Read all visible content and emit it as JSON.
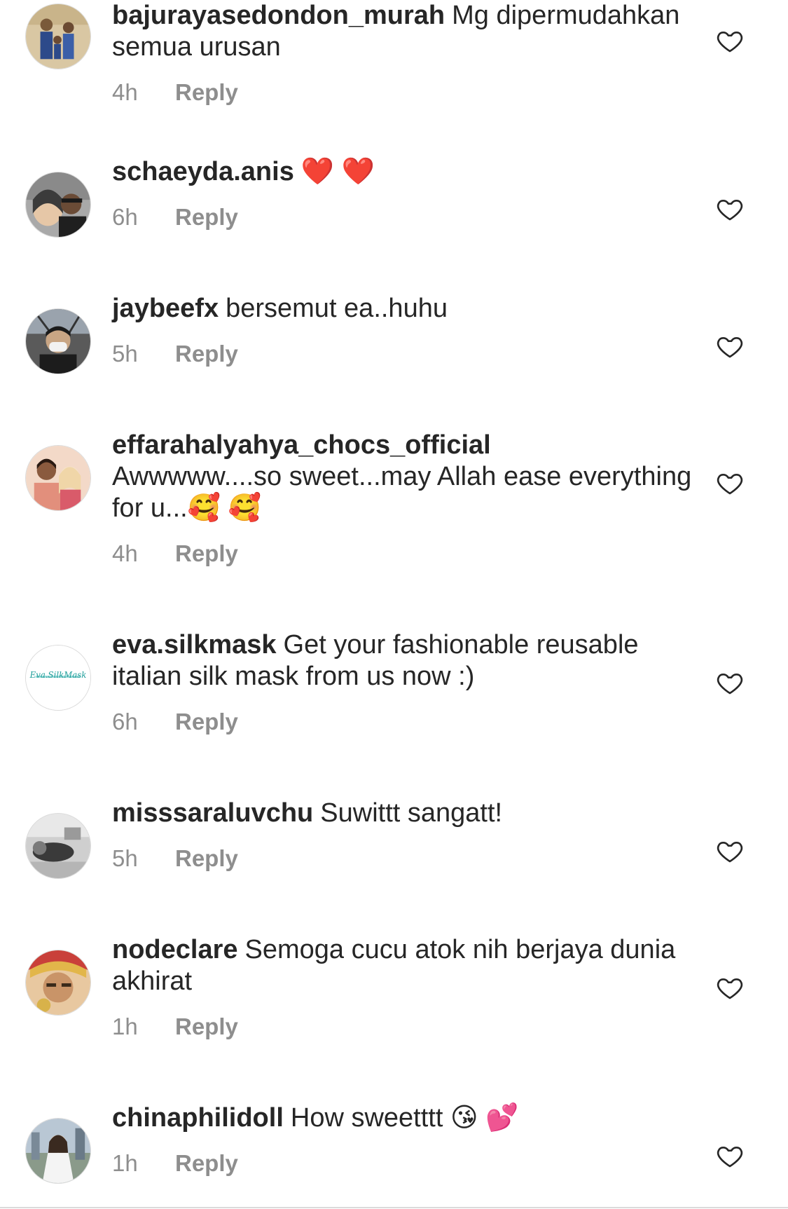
{
  "comments": [
    {
      "username": "bajurayasedondon_murah",
      "text": "Mg dipermudahkan semua urusan",
      "time": "4h",
      "reply_label": "Reply",
      "avatar_icon": "avatar-family-photo"
    },
    {
      "username": "schaeyda.anis",
      "text": "❤️ ❤️",
      "time": "6h",
      "reply_label": "Reply",
      "avatar_icon": "avatar-couple-photo"
    },
    {
      "username": "jaybeefx",
      "text": "bersemut ea..huhu",
      "time": "5h",
      "reply_label": "Reply",
      "avatar_icon": "avatar-masked-person-photo"
    },
    {
      "username": "effarahalyahya_chocs_official",
      "text": "Awwwww....so sweet...may Allah ease everything for u...🥰 🥰",
      "time": "4h",
      "reply_label": "Reply",
      "avatar_icon": "avatar-couple-photo"
    },
    {
      "username": "eva.silkmask",
      "text": "Get your fashionable reusable italian silk mask from us now :)",
      "time": "6h",
      "reply_label": "Reply",
      "avatar_icon": "avatar-logo",
      "avatar_logo_text": "Eva.SilkMask"
    },
    {
      "username": "misssaraluvchu",
      "text": "Suwittt sangatt!",
      "time": "5h",
      "reply_label": "Reply",
      "avatar_icon": "avatar-bw-photo"
    },
    {
      "username": "nodeclare",
      "text": "Semoga cucu atok nih berjaya dunia akhirat",
      "time": "1h",
      "reply_label": "Reply",
      "avatar_icon": "avatar-selfie-photo"
    },
    {
      "username": "chinaphilidoll",
      "text": "How sweetttt 😘 💕",
      "time": "1h",
      "reply_label": "Reply",
      "avatar_icon": "avatar-outdoor-photo"
    }
  ],
  "like_icon": "heart-outline-icon",
  "colors": {
    "text_primary": "#262626",
    "text_secondary": "#8e8e8e",
    "background": "#ffffff",
    "divider": "#dbdbdb"
  }
}
